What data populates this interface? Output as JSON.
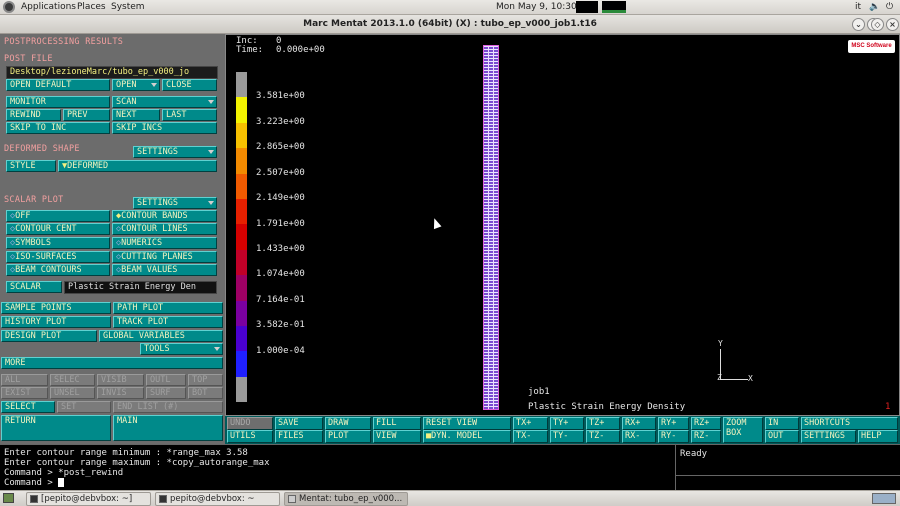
{
  "topbar": {
    "menus": [
      "Applications",
      "Places",
      "System"
    ],
    "clock": "Mon May  9, 10:30",
    "keyboard": "it"
  },
  "window": {
    "title": "Marc Mentat 2013.1.0 (64bit) (X) : tubo_ep_v000_job1.t16"
  },
  "panel": {
    "title": "POSTPROCESSING RESULTS",
    "post_file_hdr": "POST FILE",
    "post_file_path": "Desktop/lezioneMarc/tubo_ep_v000_jo",
    "open_default": "OPEN DEFAULT",
    "open": "OPEN",
    "close": "CLOSE",
    "monitor": "MONITOR",
    "scan": "SCAN",
    "rewind": "REWIND",
    "prev": "PREV",
    "next": "NEXT",
    "last": "LAST",
    "skip_to_inc": "SKIP TO INC",
    "skip_incs": "SKIP INCS",
    "deformed_hdr": "DEFORMED SHAPE",
    "deformed_settings": "SETTINGS",
    "style": "STYLE",
    "style_value": "DEFORMED",
    "scalar_hdr": "SCALAR PLOT",
    "scalar_settings": "SETTINGS",
    "off": "OFF",
    "contour_bands": "CONTOUR BANDS",
    "contour_cent": "CONTOUR CENT",
    "contour_lines": "CONTOUR LINES",
    "symbols": "SYMBOLS",
    "numerics": "NUMERICS",
    "iso_surfaces": "ISO-SURFACES",
    "cutting_planes": "CUTTING PLANES",
    "beam_contours": "BEAM CONTOURS",
    "beam_values": "BEAM VALUES",
    "scalar": "SCALAR",
    "scalar_value": "Plastic Strain Energy Den",
    "sample_points": "SAMPLE POINTS",
    "path_plot": "PATH PLOT",
    "history_plot": "HISTORY PLOT",
    "track_plot": "TRACK PLOT",
    "design_plot": "DESIGN PLOT",
    "global_variables": "GLOBAL VARIABLES",
    "tools": "TOOLS",
    "more": "MORE",
    "all": "ALL",
    "selec": "SELEC",
    "visib": "VISIB",
    "outl": "OUTL",
    "top": "TOP",
    "exist": "EXIST",
    "unsel": "UNSEL",
    "invis": "INVIS",
    "surf": "SURF",
    "bot": "BOT",
    "select": "SELECT",
    "set": "SET",
    "end_list": "END LIST (#)",
    "return": "RETURN",
    "main": "MAIN"
  },
  "viewport": {
    "inc_label": "Inc:",
    "inc_value": "0",
    "time_label": "Time:",
    "time_value": "0.000e+00",
    "legend_values": [
      "3.581e+00",
      "3.223e+00",
      "2.865e+00",
      "2.507e+00",
      "2.149e+00",
      "1.791e+00",
      "1.433e+00",
      "1.074e+00",
      "7.164e-01",
      "3.582e-01",
      "1.000e-04"
    ],
    "legend_colors": [
      "#f2f200",
      "#f6c000",
      "#f28a00",
      "#f05a00",
      "#e62000",
      "#d40000",
      "#c00028",
      "#9e0064",
      "#7a00a0",
      "#4a00d0",
      "#2020ff"
    ],
    "job": "job1",
    "quantity": "Plastic Strain Energy Density",
    "corner_num": "1",
    "axis_y": "Y",
    "axis_x": "X",
    "axis_z": "Z",
    "logo": "MSC Software"
  },
  "toolbar": {
    "undo": "UNDO",
    "save": "SAVE",
    "draw": "DRAW",
    "fill": "FILL",
    "reset_view": "RESET VIEW",
    "tx_plus": "TX+",
    "ty_plus": "TY+",
    "tz_plus": "TZ+",
    "rx_plus": "RX+",
    "ry_plus": "RY+",
    "rz_plus": "RZ+",
    "zoom": "ZOOM",
    "box": "BOX",
    "in": "IN",
    "out": "OUT",
    "shortcuts": "SHORTCUTS",
    "utils": "UTILS",
    "files": "FILES",
    "plot": "PLOT",
    "view": "VIEW",
    "dyn_model": "DYN. MODEL",
    "tx_minus": "TX-",
    "ty_minus": "TY-",
    "tz_minus": "TZ-",
    "rx_minus": "RX-",
    "ry_minus": "RY-",
    "rz_minus": "RZ-",
    "settings": "SETTINGS",
    "help": "HELP"
  },
  "console": {
    "lines": [
      "Enter contour range minimum : *range_max 3.58",
      "Enter contour range maximum : *copy_autorange_max",
      "Command > *post_rewind",
      "Command > "
    ]
  },
  "status": {
    "text": "Ready"
  },
  "taskbar": {
    "tasks": [
      "[pepito@debvbox: ~]",
      "pepito@debvbox: ~",
      "Mentat: tubo_ep_v000..."
    ]
  }
}
